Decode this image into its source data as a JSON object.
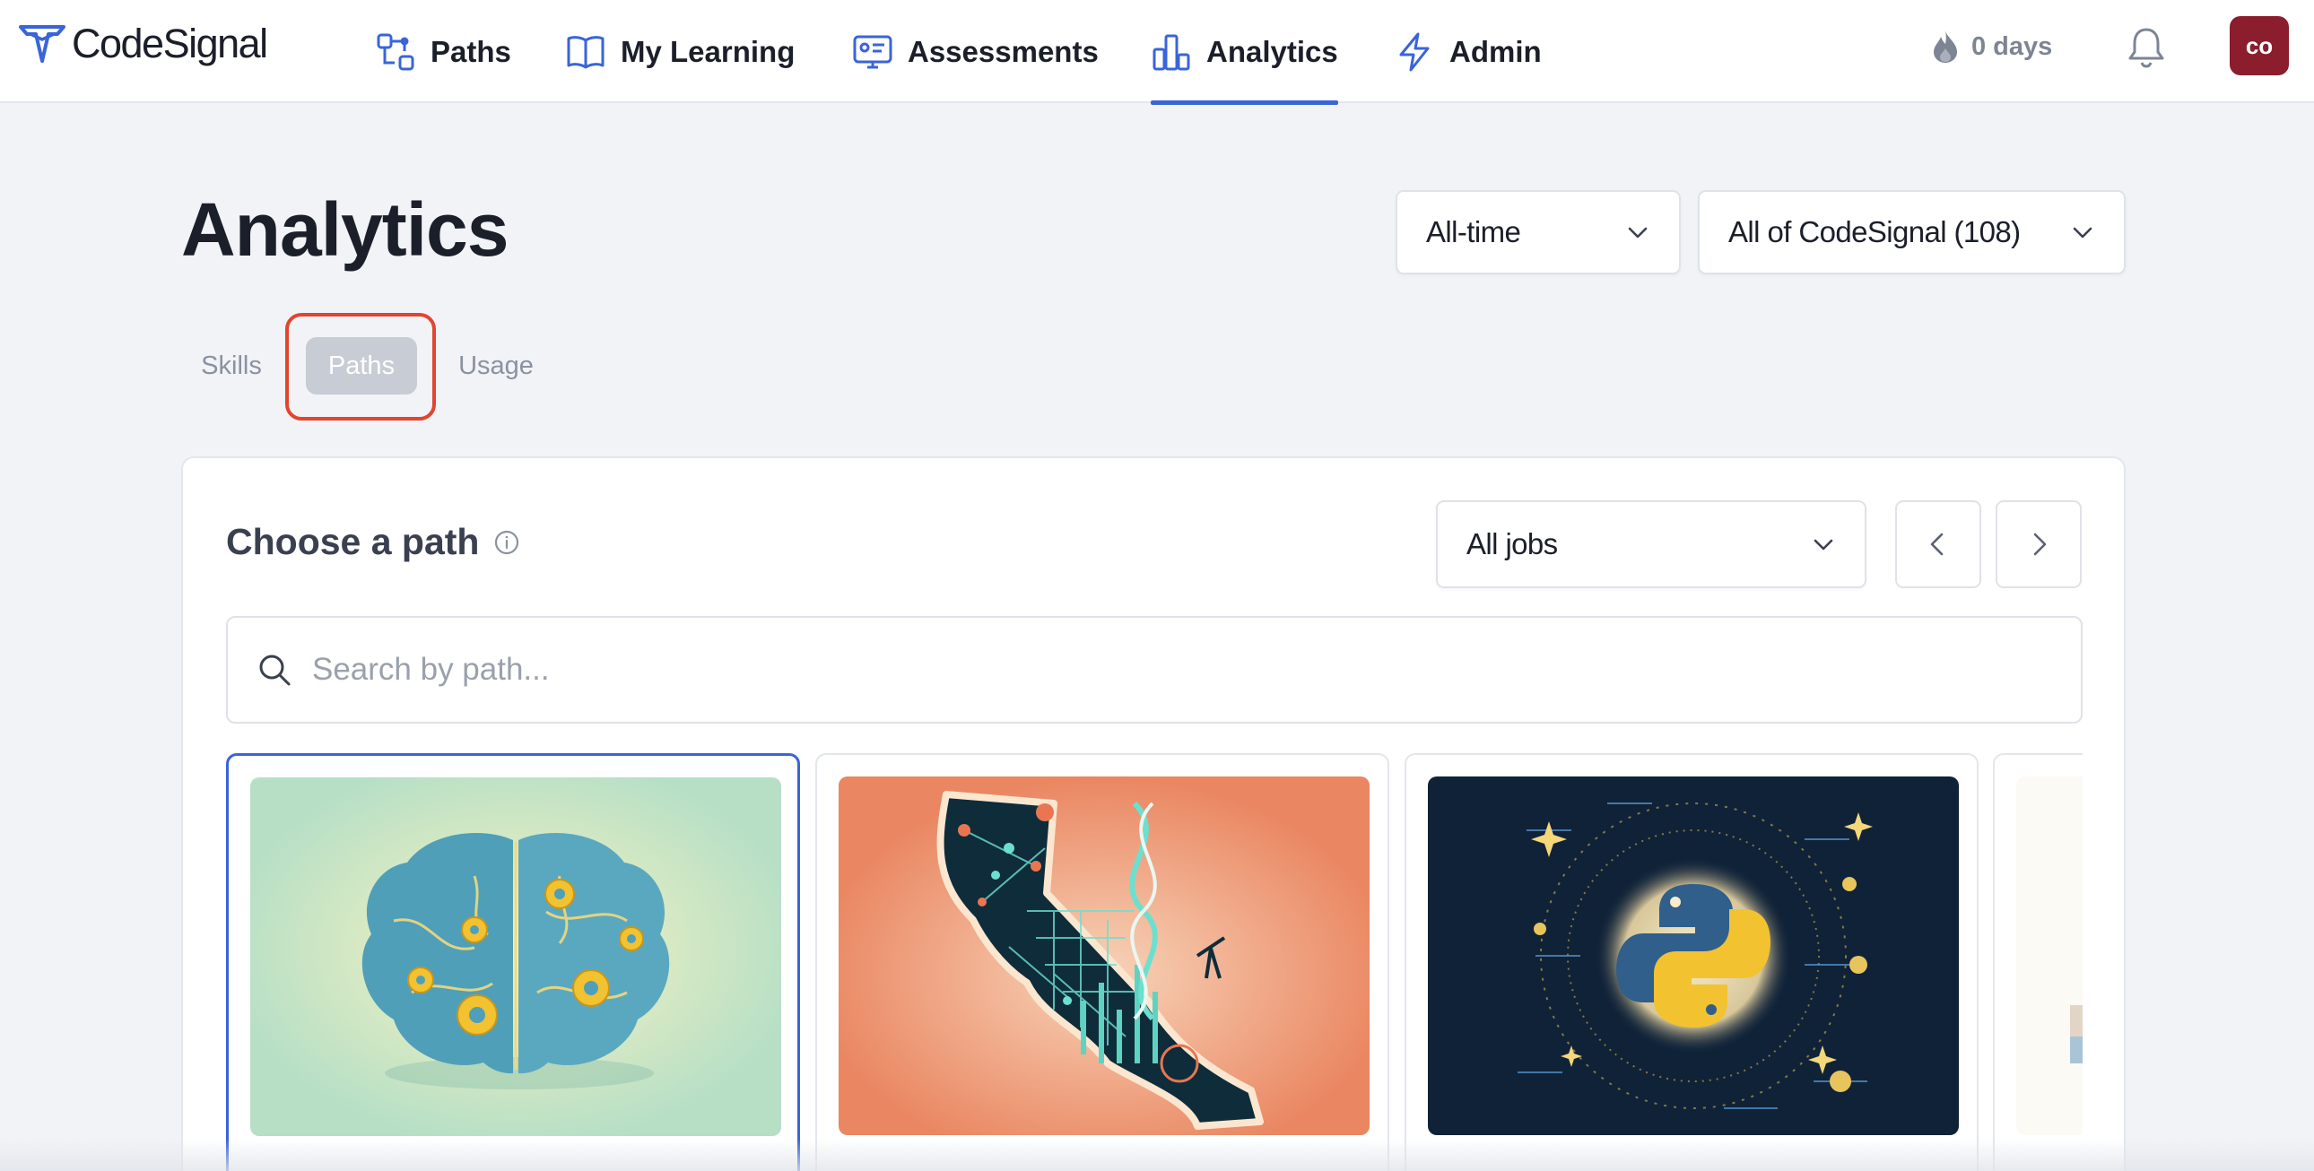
{
  "brand": {
    "name": "CodeSignal"
  },
  "nav": {
    "items": [
      {
        "label": "Paths",
        "icon": "paths-icon"
      },
      {
        "label": "My Learning",
        "icon": "book-icon"
      },
      {
        "label": "Assessments",
        "icon": "assessment-icon"
      },
      {
        "label": "Analytics",
        "icon": "analytics-icon",
        "active": true
      },
      {
        "label": "Admin",
        "icon": "lightning-icon"
      }
    ],
    "streak": "0 days",
    "avatar_initials": "co"
  },
  "header": {
    "title": "Analytics",
    "time_filter": "All-time",
    "scope_filter": "All of CodeSignal (108)"
  },
  "tabs": [
    {
      "label": "Skills"
    },
    {
      "label": "Paths",
      "selected": true
    },
    {
      "label": "Usage"
    }
  ],
  "panel": {
    "title": "Choose a path",
    "jobs_filter": "All jobs",
    "search_placeholder": "Search by path..."
  },
  "cards": [
    {
      "image": "brain-gears-illustration",
      "selected": true
    },
    {
      "image": "california-data-science-illustration"
    },
    {
      "image": "python-stars-illustration"
    },
    {
      "image": "partially-visible-illustration"
    }
  ],
  "colors": {
    "accent": "#3a64d8",
    "highlight": "#e2452f",
    "avatar": "#8b1d2c"
  }
}
